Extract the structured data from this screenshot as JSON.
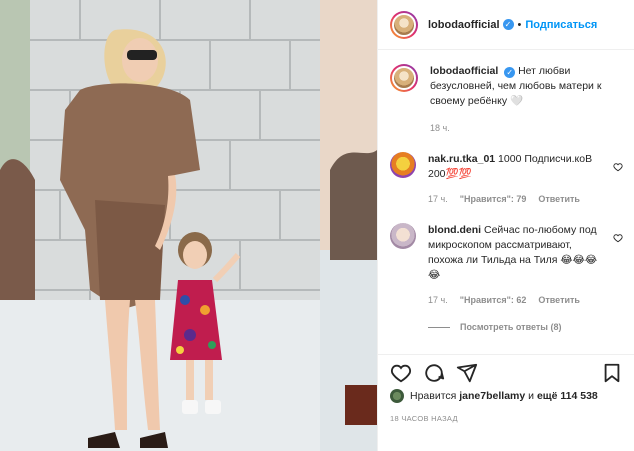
{
  "post": {
    "username": "lobodaofficial",
    "verified_mark": "✓",
    "separator": "•",
    "follow_label": "Подписаться"
  },
  "caption": {
    "username": "lobodaofficial",
    "text": "Нет любви безусловней, чем любовь матери к своему ребёнку 🤍",
    "time": "18 ч."
  },
  "comments": [
    {
      "username": "nak.ru.tka_01",
      "text": "1000 Подписчи.коВ 200💯💯",
      "time": "17 ч.",
      "likes": "\"Нравится\": 79",
      "reply_label": "Ответить"
    },
    {
      "username": "blond.deni",
      "text": "Сейчас по-любому под микроскопом рассматривают, похожа ли Тильда на Тиля 😂😂😂😂",
      "time": "17 ч.",
      "likes": "\"Нравится\": 62",
      "reply_label": "Ответить",
      "view_replies": "Посмотреть ответы (8)"
    }
  ],
  "likes_line": {
    "prefix": "Нравится",
    "user": "jane7bellamy",
    "middle": "и",
    "count": "ещё 114 538"
  },
  "timestamp": "18 ЧАСОВ НАЗАД",
  "icons": {
    "like": "heart-icon",
    "comment": "comment-icon",
    "share": "share-icon",
    "save": "bookmark-icon"
  },
  "colors": {
    "link": "#0095f6",
    "verified": "#3897f0",
    "muted": "#8e8e8e",
    "text": "#262626"
  }
}
